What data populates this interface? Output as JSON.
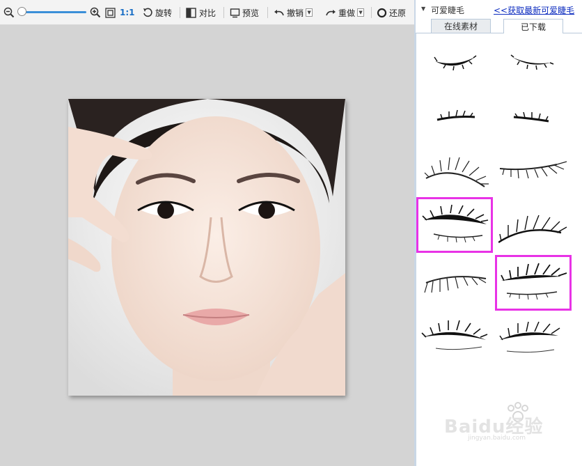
{
  "toolbar": {
    "zoom_ratio_label": "1:1",
    "rotate_label": "旋转",
    "compare_label": "对比",
    "preview_label": "预览",
    "undo_label": "撤销",
    "redo_label": "重做",
    "restore_label": "还原",
    "zoom_level": 0.03
  },
  "panel": {
    "title": "可爱睫毛",
    "get_more_link": "<<获取最新可爱睫毛",
    "tabs": [
      {
        "label": "在线素材",
        "active": false
      },
      {
        "label": "已下载",
        "active": true
      }
    ],
    "selected_items": [
      6,
      9
    ],
    "highlight_color": "#e832e6"
  },
  "watermark": {
    "brand": "Baidu经验",
    "url": "jingyan.baidu.com"
  }
}
